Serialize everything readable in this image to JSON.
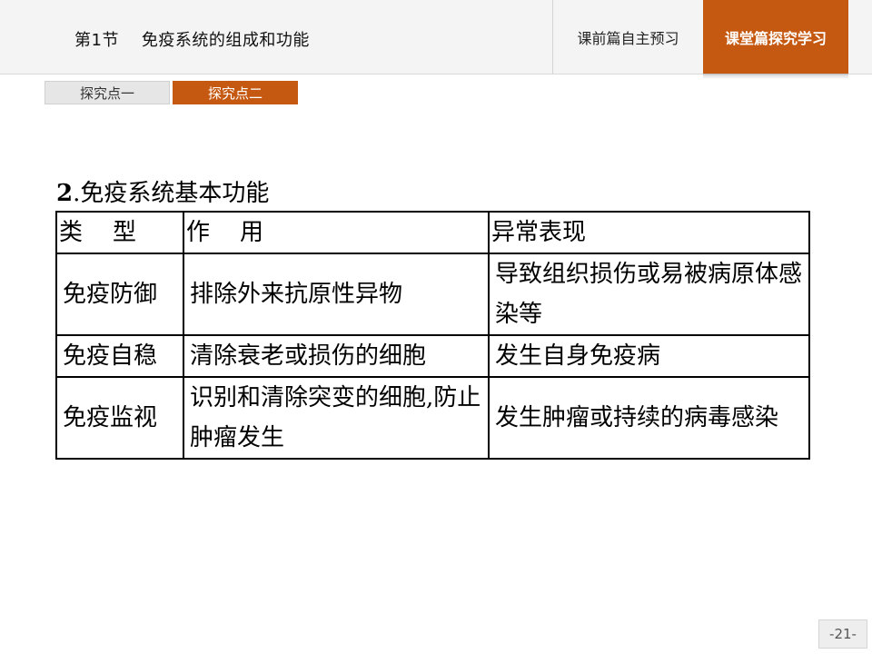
{
  "header": {
    "title": "第1节    免疫系统的组成和功能",
    "tabs": [
      {
        "label": "课前篇自主预习",
        "active": false
      },
      {
        "label": "课堂篇探究学习",
        "active": true
      }
    ]
  },
  "subtabs": [
    {
      "label": "探究点一",
      "active": false
    },
    {
      "label": "探究点二",
      "active": true
    }
  ],
  "section": {
    "number": "2",
    "title": ".免疫系统基本功能"
  },
  "table": {
    "headers": [
      "类    型",
      "作    用",
      "异常表现"
    ],
    "rows": [
      [
        "免疫防御",
        "排除外来抗原性异物",
        "导致组织损伤或易被病原体感染等"
      ],
      [
        "免疫自稳",
        "清除衰老或损伤的细胞",
        "发生自身免疫病"
      ],
      [
        "免疫监视",
        "识别和清除突变的细胞,防止肿瘤发生",
        "发生肿瘤或持续的病毒感染"
      ]
    ]
  },
  "page_number": "-21-",
  "colors": {
    "accent": "#c65911",
    "header_bg": "#f4f4f4"
  }
}
